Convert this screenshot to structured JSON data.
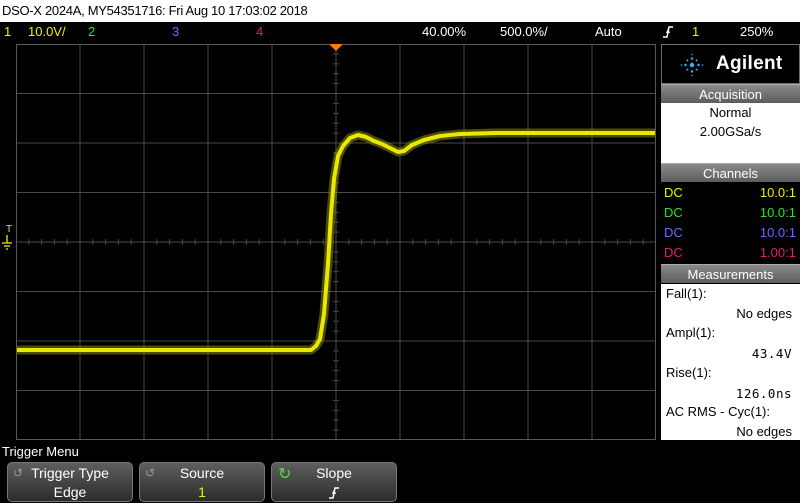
{
  "title": "DSO-X 2024A, MY54351716: Fri Aug 10 17:03:02 2018",
  "status": {
    "ch1_num": "1",
    "ch1_scale": "10.0V/",
    "ch2_num": "2",
    "ch3_num": "3",
    "ch4_num": "4",
    "time_pos": "40.00%",
    "time_scale": "500.0%/",
    "trigger_mode": "Auto",
    "trigger_icon": "rising-edge-icon",
    "trigger_src": "1",
    "trigger_level": "250%"
  },
  "graticule": {
    "cols": 10,
    "rows": 8,
    "grid": true
  },
  "markers": {
    "trigger_label": "T",
    "ground_label": "1"
  },
  "brand": "Agilent",
  "acquisition": {
    "header": "Acquisition",
    "mode": "Normal",
    "rate": "2.00GSa/s"
  },
  "channels": {
    "header": "Channels",
    "rows": [
      {
        "coupling": "DC",
        "ratio": "10.0:1",
        "color": "#f0f000"
      },
      {
        "coupling": "DC",
        "ratio": "10.0:1",
        "color": "#2ee02e"
      },
      {
        "coupling": "DC",
        "ratio": "10.0:1",
        "color": "#6a6aff"
      },
      {
        "coupling": "DC",
        "ratio": "1.00:1",
        "color": "#e0206a"
      }
    ]
  },
  "measurements": {
    "header": "Measurements",
    "items": [
      {
        "name": "Fall(1):",
        "value": "No edges"
      },
      {
        "name": "Ampl(1):",
        "value": "43.4V"
      },
      {
        "name": "Rise(1):",
        "value": "126.0ns"
      },
      {
        "name": "AC RMS - Cyc(1):",
        "value": "No edges"
      }
    ]
  },
  "menu": {
    "title": "Trigger Menu",
    "softkeys": [
      {
        "label": "Trigger Type",
        "value": "Edge",
        "icon": "knob-icon"
      },
      {
        "label": "Source",
        "value": "1",
        "icon": "knob-icon"
      },
      {
        "label": "Slope",
        "value": "↑",
        "icon": "rotate-arrow-icon"
      }
    ]
  },
  "colors": {
    "ch1": "#f0f000",
    "ch2": "#2ee02e",
    "ch3": "#6a6aff",
    "ch4": "#e0206a",
    "trigger_marker": "#ff7a00",
    "trace": "#e8e800",
    "graticule": "#4a4a4a"
  }
}
